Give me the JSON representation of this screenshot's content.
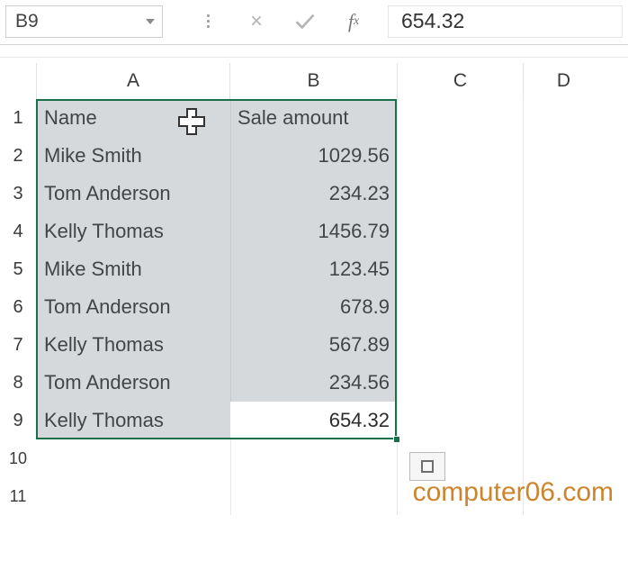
{
  "formula_bar": {
    "name_box": "B9",
    "value": "654.32"
  },
  "columns": [
    "A",
    "B",
    "C",
    "D"
  ],
  "row_numbers": [
    1,
    2,
    3,
    4,
    5,
    6,
    7,
    8,
    9,
    10,
    11
  ],
  "headers": {
    "name": "Name",
    "sale_amount": "Sale amount"
  },
  "rows": [
    {
      "name": "Mike Smith",
      "amount": "1029.56"
    },
    {
      "name": "Tom Anderson",
      "amount": "234.23"
    },
    {
      "name": "Kelly Thomas",
      "amount": "1456.79"
    },
    {
      "name": "Mike Smith",
      "amount": "123.45"
    },
    {
      "name": "Tom Anderson",
      "amount": "678.9"
    },
    {
      "name": "Kelly Thomas",
      "amount": "567.89"
    },
    {
      "name": "Tom Anderson",
      "amount": "234.56"
    },
    {
      "name": "Kelly Thomas",
      "amount": "654.32"
    }
  ],
  "active_cell": "654.32",
  "watermark": "computer06.com"
}
